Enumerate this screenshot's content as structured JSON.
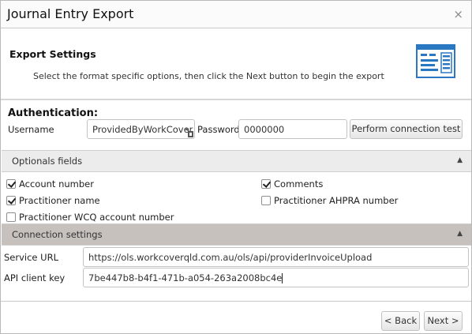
{
  "window": {
    "title": "Journal Entry Export",
    "close_symbol": "×"
  },
  "header": {
    "title": "Export Settings",
    "description": "Select the format specific options, then click the Next button to begin the export",
    "icon": "export-settings-icon"
  },
  "authentication": {
    "title": "Authentication:",
    "username_label": "Username",
    "username_value": "ProvidedByWorkCover",
    "password_label": "Password",
    "password_value": "0000000",
    "test_button": "Perform connection test"
  },
  "optional_fields": {
    "title": "Optionals fields",
    "toggle": "▲",
    "items": [
      {
        "label": "Account number",
        "checked": true
      },
      {
        "label": "Comments",
        "checked": true
      },
      {
        "label": "Practitioner name",
        "checked": true
      },
      {
        "label": "Practitioner AHPRA number",
        "checked": false
      },
      {
        "label": "Practitioner WCQ account number",
        "checked": false
      }
    ]
  },
  "connection": {
    "title": "Connection settings",
    "toggle": "▲",
    "service_url_label": "Service URL",
    "service_url_value": "https://ols.workcoverqld.com.au/ols/api/providerInvoiceUpload",
    "api_key_label": "API client key",
    "api_key_value": "7be447b8-b4f1-471b-a054-263a2008bc4e"
  },
  "footer": {
    "back_label": "< Back",
    "next_label": "Next >"
  },
  "colors": {
    "connection_header_bg": "#c7c1be",
    "optional_header_bg": "#ececec",
    "icon_blue": "#2b78c2"
  }
}
